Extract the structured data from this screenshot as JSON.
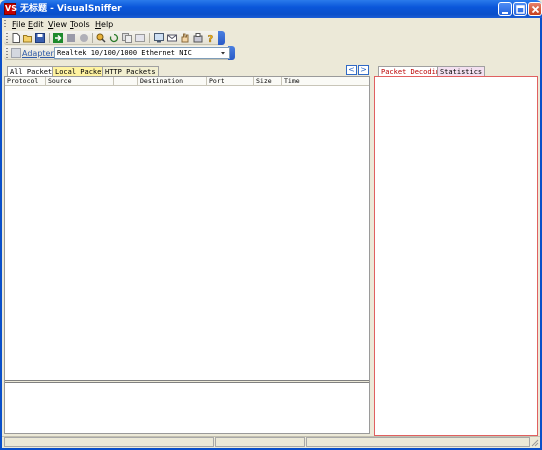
{
  "window": {
    "title": "无标题 - VisualSniffer",
    "app_icon_text": "VS"
  },
  "menu": [
    {
      "label": "File",
      "mnemonic": "F"
    },
    {
      "label": "Edit",
      "mnemonic": "E"
    },
    {
      "label": "View",
      "mnemonic": "V"
    },
    {
      "label": "Tools",
      "mnemonic": "T"
    },
    {
      "label": "Help",
      "mnemonic": "H"
    }
  ],
  "toolbar": {
    "icons": [
      "new-icon",
      "open-icon",
      "save-icon",
      "start-capture-icon",
      "pause-icon",
      "stop-icon",
      "filter-icon",
      "refresh-icon",
      "copy-icon",
      "export-icon",
      "monitor-icon",
      "envelope-icon",
      "hand-icon",
      "settings-icon",
      "help-icon"
    ]
  },
  "adapter": {
    "label": "Adapter:",
    "value": "Realtek 10/100/1000 Ethernet NIC"
  },
  "left_tabs": [
    "All Packets",
    "Local Packets",
    "HTTP Packets"
  ],
  "nav": {
    "prev": "<",
    "next": ">"
  },
  "columns": [
    "Protocol",
    "Source",
    "",
    "Destination",
    "Port",
    "Size",
    "Time"
  ],
  "right_tabs": [
    "Packet Decoding",
    "Statistics"
  ],
  "colors": {
    "titlebar": "#0A56DA",
    "accent": "#316AC5",
    "right_border": "#E06060"
  }
}
